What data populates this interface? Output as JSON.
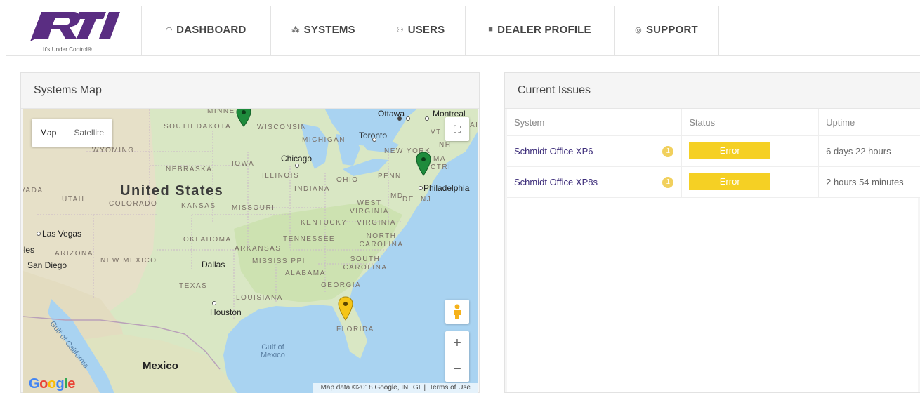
{
  "brand": {
    "logo_text": "RTI",
    "tagline": "It's Under Control®",
    "color": "#5a2d82"
  },
  "nav": {
    "items": [
      {
        "label": "DASHBOARD",
        "icon": "gauge-icon"
      },
      {
        "label": "SYSTEMS",
        "icon": "sitemap-icon"
      },
      {
        "label": "USERS",
        "icon": "users-icon"
      },
      {
        "label": "DEALER PROFILE",
        "icon": "briefcase-icon"
      },
      {
        "label": "SUPPORT",
        "icon": "lifebuoy-icon"
      }
    ]
  },
  "map_panel": {
    "title": "Systems Map",
    "map_type": {
      "map": "Map",
      "satellite": "Satellite"
    },
    "labels": {
      "south_dakota": "SOUTH DAKOTA",
      "wyoming": "WYOMING",
      "nebraska": "NEBRASKA",
      "iowa": "IOWA",
      "illinois": "ILLINOIS",
      "wisconsin": "WISCONSIN",
      "michigan": "MICHIGAN",
      "ohio": "OHIO",
      "indiana": "INDIANA",
      "penn": "PENN",
      "new_york": "NEW YORK",
      "ma": "MA",
      "ctri": "CTRI",
      "vt": "VT",
      "nh": "NH",
      "md": "MD",
      "de": "DE",
      "nj": "NJ",
      "minne": "MINNE",
      "ain": "AIN",
      "west_virginia": "WEST VIRGINIA",
      "virginia": "VIRGINIA",
      "kentucky": "KENTUCKY",
      "tennessee": "TENNESSEE",
      "north_carolina": "NORTH CAROLINA",
      "south_carolina": "SOUTH CAROLINA",
      "georgia": "GEORGIA",
      "alabama": "ALABAMA",
      "mississippi": "MISSISSIPPI",
      "arkansas": "ARKANSAS",
      "oklahoma": "OKLAHOMA",
      "kansas": "KANSAS",
      "missouri": "MISSOURI",
      "colorado": "COLORADO",
      "utah": "UTAH",
      "vada": "VADA",
      "arizona": "ARIZONA",
      "new_mexico": "NEW MEXICO",
      "texas": "TEXAS",
      "louisiana": "LOUISIANA",
      "florida": "FLORIDA",
      "country": "United States",
      "mexico": "Mexico",
      "gulf_mexico_1": "Gulf of",
      "gulf_mexico_2": "Mexico",
      "gulf_california": "Gulf of California",
      "ottawa": "Ottawa",
      "montreal": "Montreal",
      "toronto": "Toronto",
      "chicago": "Chicago",
      "philadelphia": "Philadelphia",
      "las_vegas": "Las Vegas",
      "eles": "eles",
      "san_diego": "San Diego",
      "dallas": "Dallas",
      "houston": "Houston"
    },
    "google": "Google",
    "attribution": {
      "data": "Map data ©2018 Google, INEGI",
      "terms": "Terms of Use"
    },
    "markers": [
      {
        "name": "marker-north",
        "color": "#1e8b3c",
        "status": "ok"
      },
      {
        "name": "marker-east",
        "color": "#1e8b3c",
        "status": "ok"
      },
      {
        "name": "marker-florida",
        "color": "#f5c518",
        "status": "error"
      }
    ]
  },
  "issues_panel": {
    "title": "Current Issues",
    "columns": [
      "System",
      "Status",
      "Uptime"
    ],
    "rows": [
      {
        "system": "Schmidt Office XP6",
        "count": "1",
        "status": "Error",
        "uptime": "6 days 22 hours"
      },
      {
        "system": "Schmidt Office XP8s",
        "count": "1",
        "status": "Error",
        "uptime": "2 hours 54 minutes"
      }
    ]
  },
  "colors": {
    "error": "#f5d024",
    "ok_marker": "#1e8b3c",
    "link": "#3a2a78"
  }
}
